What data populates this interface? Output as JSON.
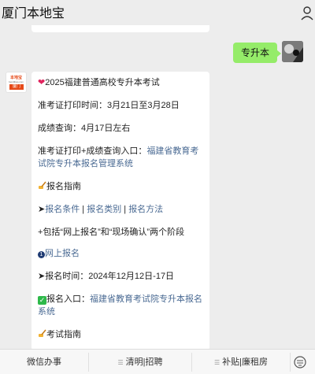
{
  "app": {
    "title": "厦门本地宝"
  },
  "chat": {
    "my_message": "专升本",
    "bot_avatar": {
      "logo_top": "本地宝",
      "logo_mid": "bendibao.com",
      "logo_city": "厦门"
    },
    "lines": {
      "l1_text": "2025福建普通高校专升本考试",
      "l2_text": "准考证打印时间：3月21日至3月28日",
      "l3_text": "成绩查询：4月17日左右",
      "l4_prefix": "准考证打印+成绩查询入口：",
      "l4_link": "福建省教育考试院专升本报名管理系统",
      "l5_text": "报名指南",
      "l6_arrow": "➤",
      "l6_link1": "报名条件",
      "l6_sep1": " | ",
      "l6_link2": "报名类别",
      "l6_sep2": " | ",
      "l6_link3": "报名方法",
      "l7_text": "包括“网上报名”和“现场确认”两个阶段",
      "l8_link": "网上报名",
      "l9_text": "➤报名时间：2024年12月12日-17日",
      "l10_prefix": "报名入口：",
      "l10_link": "福建省教育考试院专升本报名系统",
      "l11_text": "考试指南"
    }
  },
  "bottom_tabs": {
    "tab1": "微信办事",
    "tab2": "清明|招聘",
    "tab3": "补贴|廉租房"
  },
  "colors": {
    "background": "#ededed",
    "my_bubble": "#95ec69",
    "link": "#4a6a93",
    "brand": "#e64a19"
  },
  "icons": [
    "user-icon",
    "heart-icon",
    "pencil-hand-icon",
    "dot-icon",
    "check-icon",
    "keyboard-icon",
    "menu-icon"
  ]
}
